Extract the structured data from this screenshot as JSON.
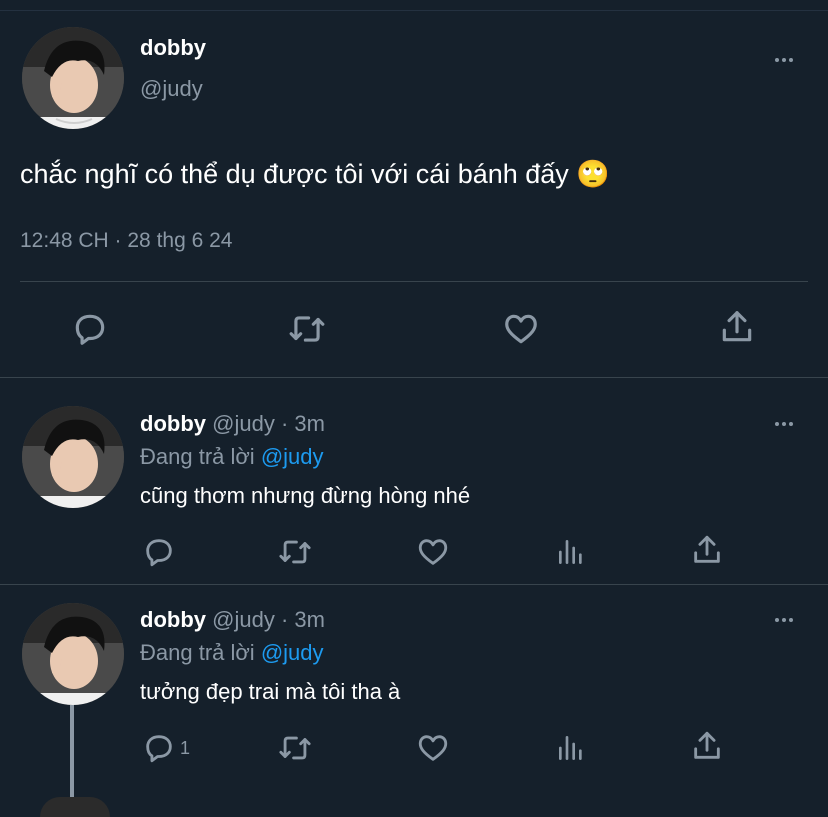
{
  "main_tweet": {
    "display_name": "dobby",
    "handle": "@judy",
    "text": "chắc nghĩ có thể dụ được tôi với cái bánh đấy 🙄",
    "timestamp": "12:48 CH · 28 thg 6 24"
  },
  "replies": [
    {
      "display_name": "dobby",
      "handle": "@judy",
      "separator": "·",
      "time": "3m",
      "replying_label": "Đang trả lời",
      "replying_to": "@judy",
      "text": "cũng thơm nhưng đừng hòng nhé",
      "reply_count": ""
    },
    {
      "display_name": "dobby",
      "handle": "@judy",
      "separator": "·",
      "time": "3m",
      "replying_label": "Đang trả lời",
      "replying_to": "@judy",
      "text": "tưởng đẹp trai mà tôi tha à",
      "reply_count": "1"
    }
  ],
  "colors": {
    "background": "#15202b",
    "muted": "#8b98a5",
    "link": "#1d9bf0",
    "divider": "#38444d"
  },
  "icons": [
    "more-icon",
    "reply-icon",
    "retweet-icon",
    "like-icon",
    "views-icon",
    "share-icon"
  ]
}
